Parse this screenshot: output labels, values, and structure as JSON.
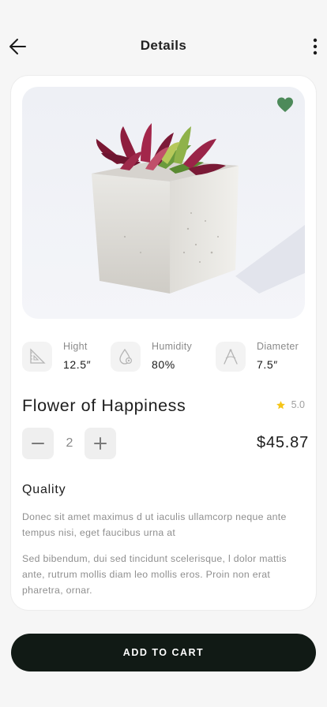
{
  "header": {
    "title": "Details",
    "back_icon": "arrow-left-icon",
    "more_icon": "more-vertical-icon"
  },
  "product": {
    "name": "Flower of Happiness",
    "rating": "5.0",
    "favorite": true,
    "favorite_color": "#4d8a5a",
    "image_icon": "succulent-in-concrete-pot-image"
  },
  "specs": [
    {
      "label": "Hight",
      "value": "12.5″",
      "icon": "set-square-icon"
    },
    {
      "label": "Humidity",
      "value": "80%",
      "icon": "water-drop-icon"
    },
    {
      "label": "Diameter",
      "value": "7.5″",
      "icon": "compass-icon"
    }
  ],
  "quantity": {
    "value": "2",
    "decrement_icon": "minus-icon",
    "increment_icon": "plus-icon"
  },
  "price": "$45.87",
  "quality": {
    "title": "Quality",
    "paragraphs": [
      "Donec sit amet maximus d ut iaculis ullamcorp neque ante tempus nisi, eget faucibus urna at",
      "Sed bibendum, dui sed tincidunt scelerisque, l dolor mattis ante, rutrum mollis diam leo mollis eros. Proin non erat pharetra, ornar."
    ]
  },
  "cta": {
    "label": "ADD TO CART",
    "color": "#111a15"
  },
  "colors": {
    "star": "#f5c518",
    "background": "#f6f6f6"
  }
}
